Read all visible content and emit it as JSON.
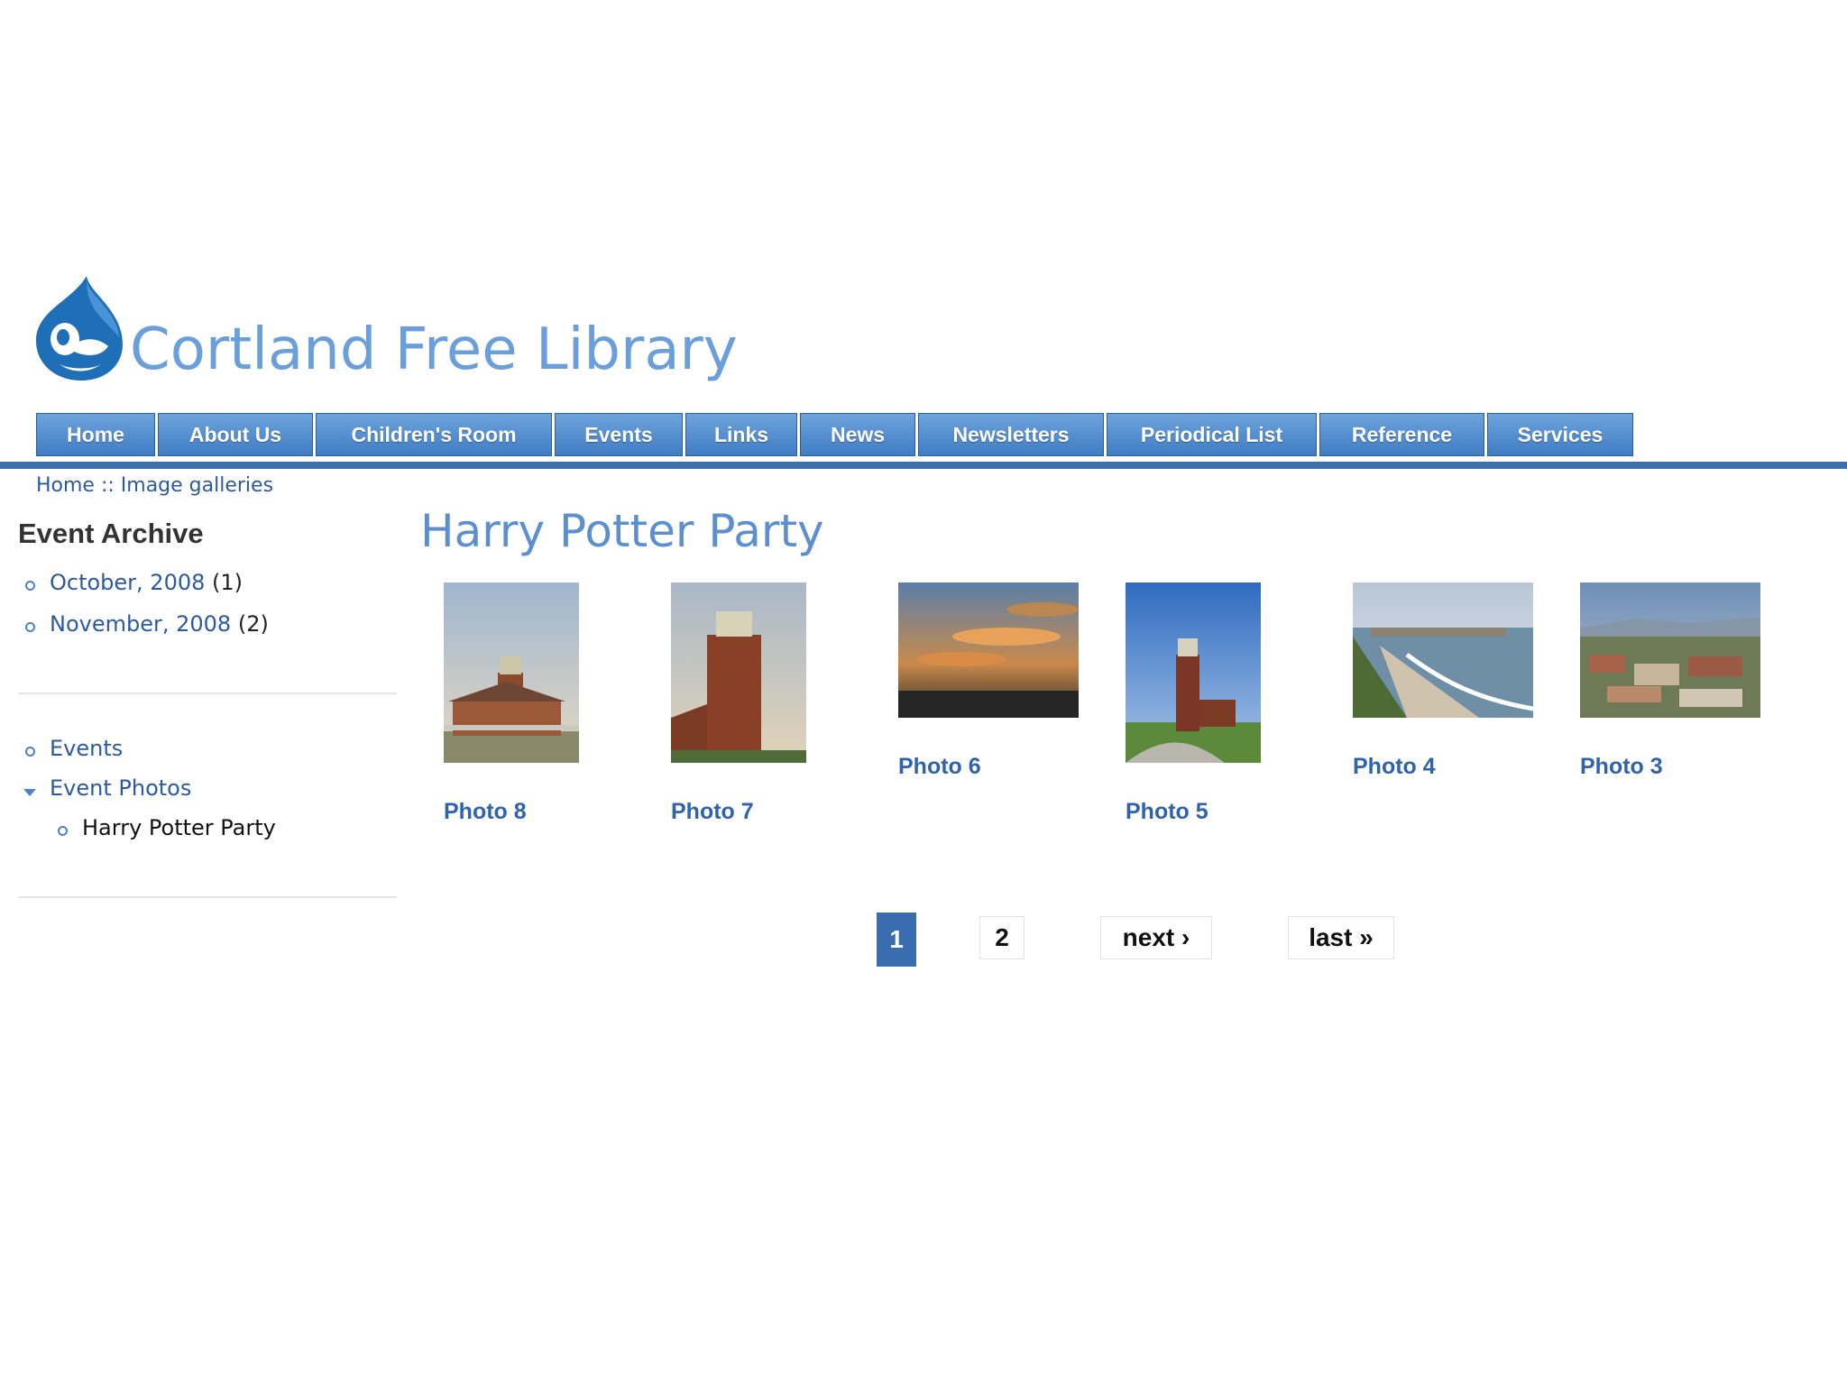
{
  "site": {
    "name": "Cortland Free Library"
  },
  "nav": {
    "items": [
      "Home",
      "About Us",
      "Children's Room",
      "Events",
      "Links",
      "News",
      "Newsletters",
      "Periodical List",
      "Reference",
      "Services"
    ]
  },
  "breadcrumb": {
    "home": "Home",
    "separator": " :: ",
    "current": "Image galleries"
  },
  "sidebar": {
    "archive_title": "Event Archive",
    "archive": [
      {
        "label": "October, 2008",
        "count": "(1)"
      },
      {
        "label": "November, 2008",
        "count": "(2)"
      }
    ],
    "menu": [
      {
        "label": "Events"
      },
      {
        "label": "Event Photos"
      },
      {
        "label": "Harry Potter Party"
      }
    ]
  },
  "gallery": {
    "title": "Harry Potter Party",
    "photos": [
      {
        "label": "Photo 8",
        "subject": "lighthouse at dusk"
      },
      {
        "label": "Photo 7",
        "subject": "lighthouse tower"
      },
      {
        "label": "Photo 6",
        "subject": "sunset clouds"
      },
      {
        "label": "Photo 5",
        "subject": "lighthouse blue sky"
      },
      {
        "label": "Photo 4",
        "subject": "beach coastline"
      },
      {
        "label": "Photo 3",
        "subject": "town view"
      }
    ]
  },
  "pager": {
    "page1": "1",
    "page2": "2",
    "next": "next ›",
    "last": "last »"
  },
  "colors": {
    "brand": "#6a9fdc",
    "link": "#2c5aa0",
    "nav_bar": "#3e6fa8",
    "pager_current": "#3a6db0"
  }
}
